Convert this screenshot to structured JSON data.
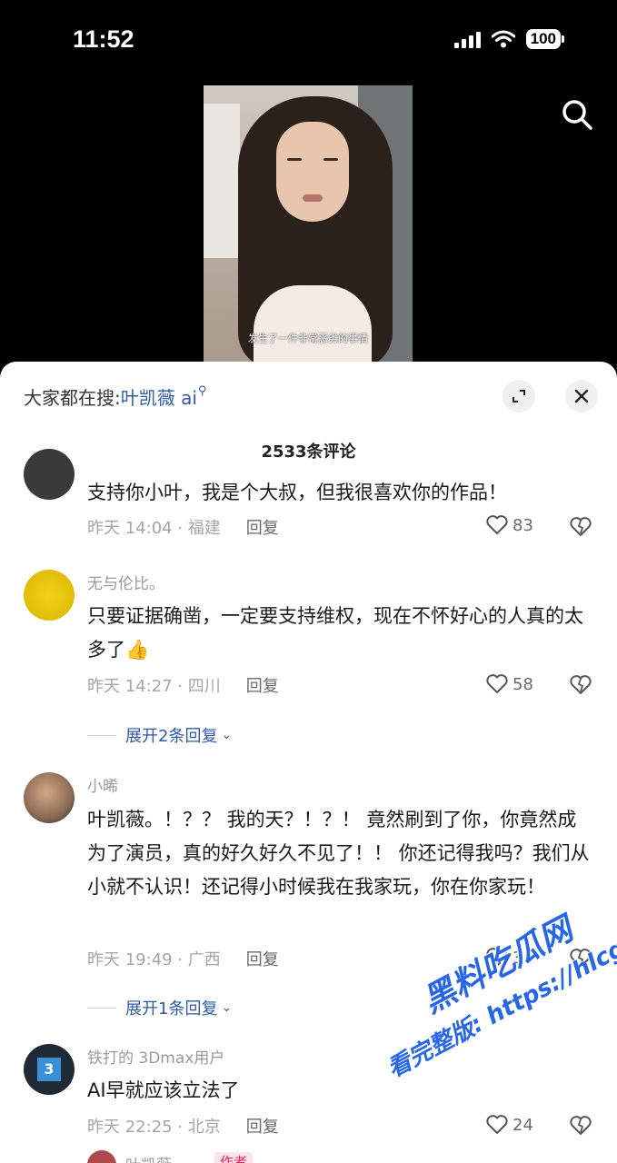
{
  "status_bar": {
    "time": "11:52",
    "battery": "100"
  },
  "video": {
    "subtitle": "发生了一件非常恶劣的事情"
  },
  "sheet": {
    "search_prefix": "大家都在搜:",
    "search_keyword": "叶凯薇 ai",
    "comment_count": "2533条评论"
  },
  "comments": [
    {
      "user": "",
      "text": "支持你小叶，我是个大叔，但我很喜欢你的作品！",
      "date": "昨天 14:04 · 福建",
      "reply": "回复",
      "likes": "83"
    },
    {
      "user": "无与伦比。",
      "text": "只要证据确凿，一定要支持维权，现在不怀好心的人真的太多了👍",
      "date": "昨天 14:27 · 四川",
      "reply": "回复",
      "likes": "58",
      "expand": "展开2条回复"
    },
    {
      "user": "小晞",
      "text": "叶凯薇。！？？ 我的天？！？！ 竟然刷到了你，你竟然成为了演员，真的好久好久不见了！！ 你还记得我吗？我们从小就不认识！还记得小时候我在我家玩，你在你家玩！",
      "date": "昨天 19:49 · 广西",
      "reply": "回复",
      "likes": "34",
      "expand": "展开1条回复"
    },
    {
      "user": "铁打的 3Dmax用户",
      "text": "AI早就应该立法了",
      "date": "昨天 22:25 · 北京",
      "reply": "回复",
      "likes": "24"
    },
    {
      "user": "叶凯薇",
      "badge": "作者"
    }
  ],
  "watermark": {
    "line1": "黑料吃瓜网",
    "line2": "看完整版: https://hlcgw.co"
  },
  "colors": {
    "accent": "#2f5aa8",
    "sheet_bg": "#ffffff",
    "bg": "#000000"
  }
}
